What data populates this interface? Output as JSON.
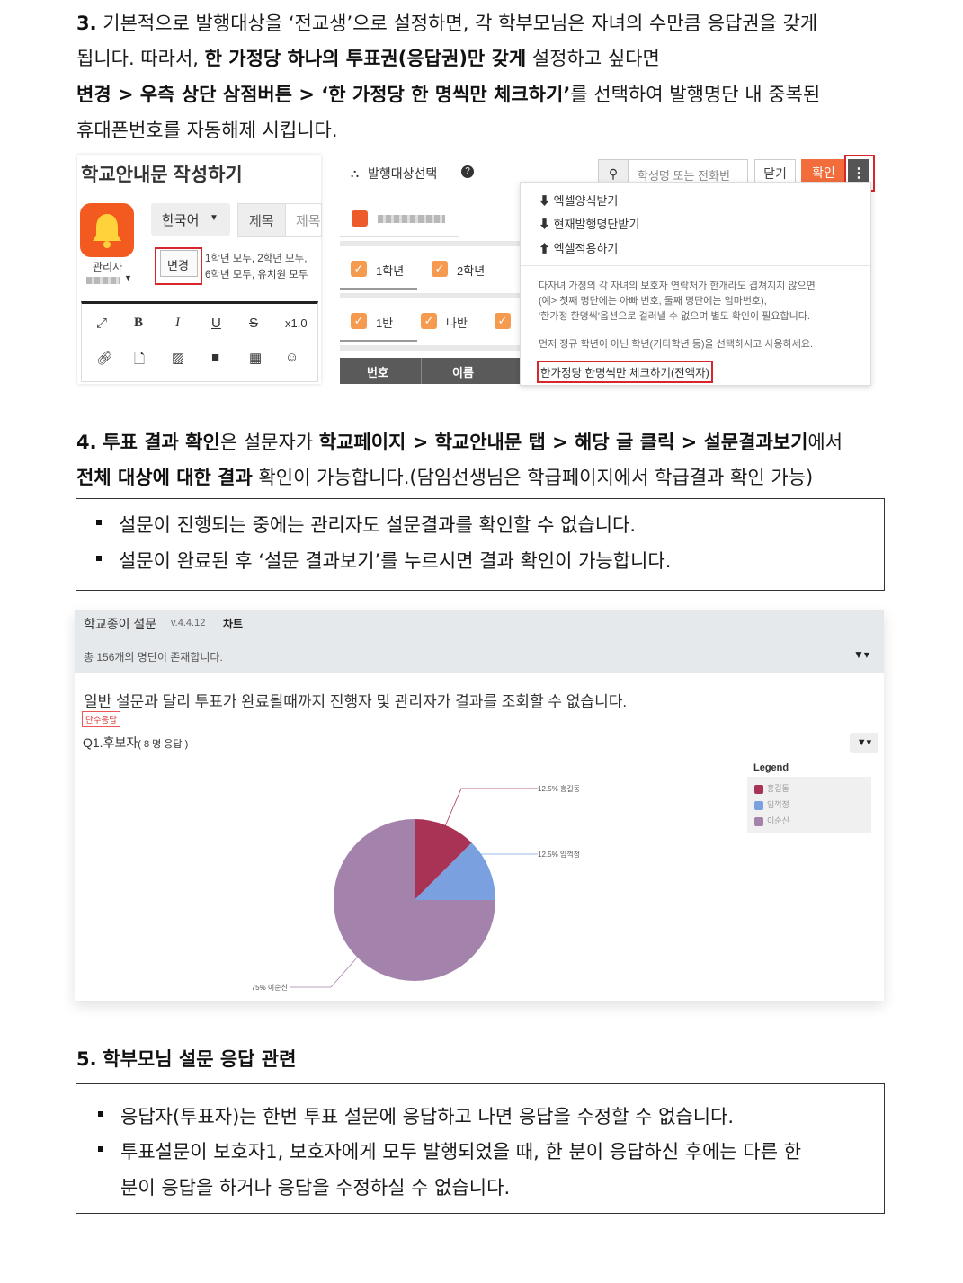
{
  "section3": {
    "num": "3.",
    "l1_a": "기본적으로 발행대상을 ‘전교생’으로 설정하면, 각 학부모님은 자녀의 수만큼 응답권을 갖게",
    "l2_a": "됩니다. 따라서, ",
    "l2_b": "한 가정당 하나의 투표권(응답권)만 갖게",
    "l2_c": " 설정하고 싶다면",
    "l3_a": "변경 > 우측 상단 삼점버튼 > ‘한 가정당 한 명씩만 체크하기’",
    "l3_b": "를 선택하여 발행명단 내 중복된",
    "l4_a": "휴대폰번호를 자동해제 시킵니다."
  },
  "shot1": {
    "title": "학교안내문 작성하기",
    "admin_label": "관리자",
    "lang_select": "한국어",
    "subject_label": "제목",
    "subject_placeholder": "제목",
    "change_button": "변경",
    "grades_line1": "1학년 모두, 2학년 모두,",
    "grades_line2": "6학년 모두, 유치원 모두",
    "zoom": "x1.0",
    "target_title": "발행대상선택",
    "search_placeholder": "학생명 또는 전화번",
    "close_button": "닫기",
    "confirm_button": "확인",
    "grade1": "1학년",
    "grade2": "2학년",
    "class1": "1반",
    "class2": "나반",
    "col_no": "번호",
    "col_name": "이름",
    "menu": {
      "item1": "엑셀양식받기",
      "item2": "현재발행명단받기",
      "item3": "엑셀적용하기",
      "note1": "다자녀 가정의 각 자녀의 보호자 연락처가 한개라도 겹쳐지지 않으면",
      "note2": "(예> 첫째 명단에는 아빠 번호, 둘째 명단에는 엄마번호),",
      "note3": "'한가정 한명씩'옵션으로 걸러낼 수 없으며 별도 확인이 필요합니다.",
      "note4": "먼저 정규 학년이 아닌 학년(기타학년 등)을 선택하시고 사용하세요.",
      "one_per_family": "한가정당 한명씩만 체크하기(전액자)"
    }
  },
  "section4": {
    "num": "4.",
    "l1_a": "투표 결과 확인",
    "l1_b": "은 설문자가 ",
    "l1_c": "학교페이지 > 학교안내문 탭 > 해당 글 클릭 > 설문결과보기",
    "l1_d": "에서",
    "l2_a": "전체 대상에 대한 결과",
    "l2_b": " 확인이 가능합니다.(담임선생님은 학급페이지에서 학급결과 확인 가능)",
    "bullets": [
      "설문이 진행되는 중에는 관리자도 설문결과를 확인할 수 없습니다.",
      "설문이 완료된 후 ‘설문 결과보기’를 누르시면 결과 확인이 가능합니다."
    ]
  },
  "shot2": {
    "app_title": "학교종이 설문",
    "version": "v.4.4.12",
    "tab_chart": "차트",
    "count_text": "총 156개의 명단이 존재합니다.",
    "notice": "일반 설문과 달리 투표가 완료될때까지 진행자 및 관리자가 결과를 조회할 수 없습니다.",
    "badge": "단수응답",
    "question": "Q1.후보자",
    "responses": "( 8 명 응답 )",
    "legend_title": "Legend"
  },
  "chart_data": {
    "type": "pie",
    "categories": [
      "홍길동",
      "임꺽정",
      "이순신"
    ],
    "values": [
      12.5,
      12.5,
      75
    ],
    "labels": [
      "12.5% 홍길동",
      "12.5% 임꺽정",
      "75% 이순신"
    ],
    "colors": [
      "#a83355",
      "#7ba0e0",
      "#a382ab"
    ],
    "legend_title": "Legend",
    "legend_position": "top-right"
  },
  "section5": {
    "num": "5.",
    "title": "학부모님 설문 응답 관련",
    "b1": "응답자(투표자)는 한번 투표 설문에 응답하고 나면 응답을 수정할 수 없습니다.",
    "b2_l1": "투표설문이 보호자1, 보호자에게 모두 발행되었을 때, 한 분이 응답하신 후에는 다른 한",
    "b2_l2": "분이 응답을 하거나 응답을 수정하실 수 없습니다."
  }
}
